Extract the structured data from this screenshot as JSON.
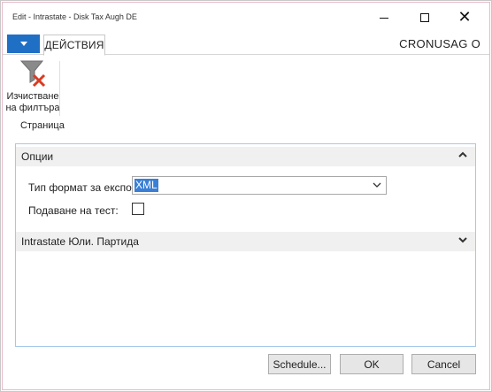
{
  "window": {
    "title": "Edit - Intrastate - Disk Tax Augh DE",
    "minimize_icon": "minimize-icon",
    "maximize_icon": "maximize-icon",
    "close_glyph": "✕"
  },
  "ribbon": {
    "app_menu_icon": "dropdown-arrow-icon",
    "tab_actions": "ДЕЙСТВИЯ",
    "company": "CRONUSAG O",
    "clear_filter_line1": "Изчистване",
    "clear_filter_line2": "на филтъра",
    "group_label": "Страница"
  },
  "options_tab": {
    "title": "Опции",
    "format_label": "Тип формат за експортиране:",
    "format_value": "XML",
    "test_label": "Подаване на тест:",
    "test_checked": false
  },
  "batch_tab": {
    "title": "Intrastate Юли. Партида"
  },
  "buttons": {
    "schedule": "Schedule...",
    "ok": "OK",
    "cancel": "Cancel"
  },
  "colors": {
    "accent": "#1f6fc5",
    "selection": "#3a7fd5",
    "focus_border": "#a5c8ea"
  }
}
